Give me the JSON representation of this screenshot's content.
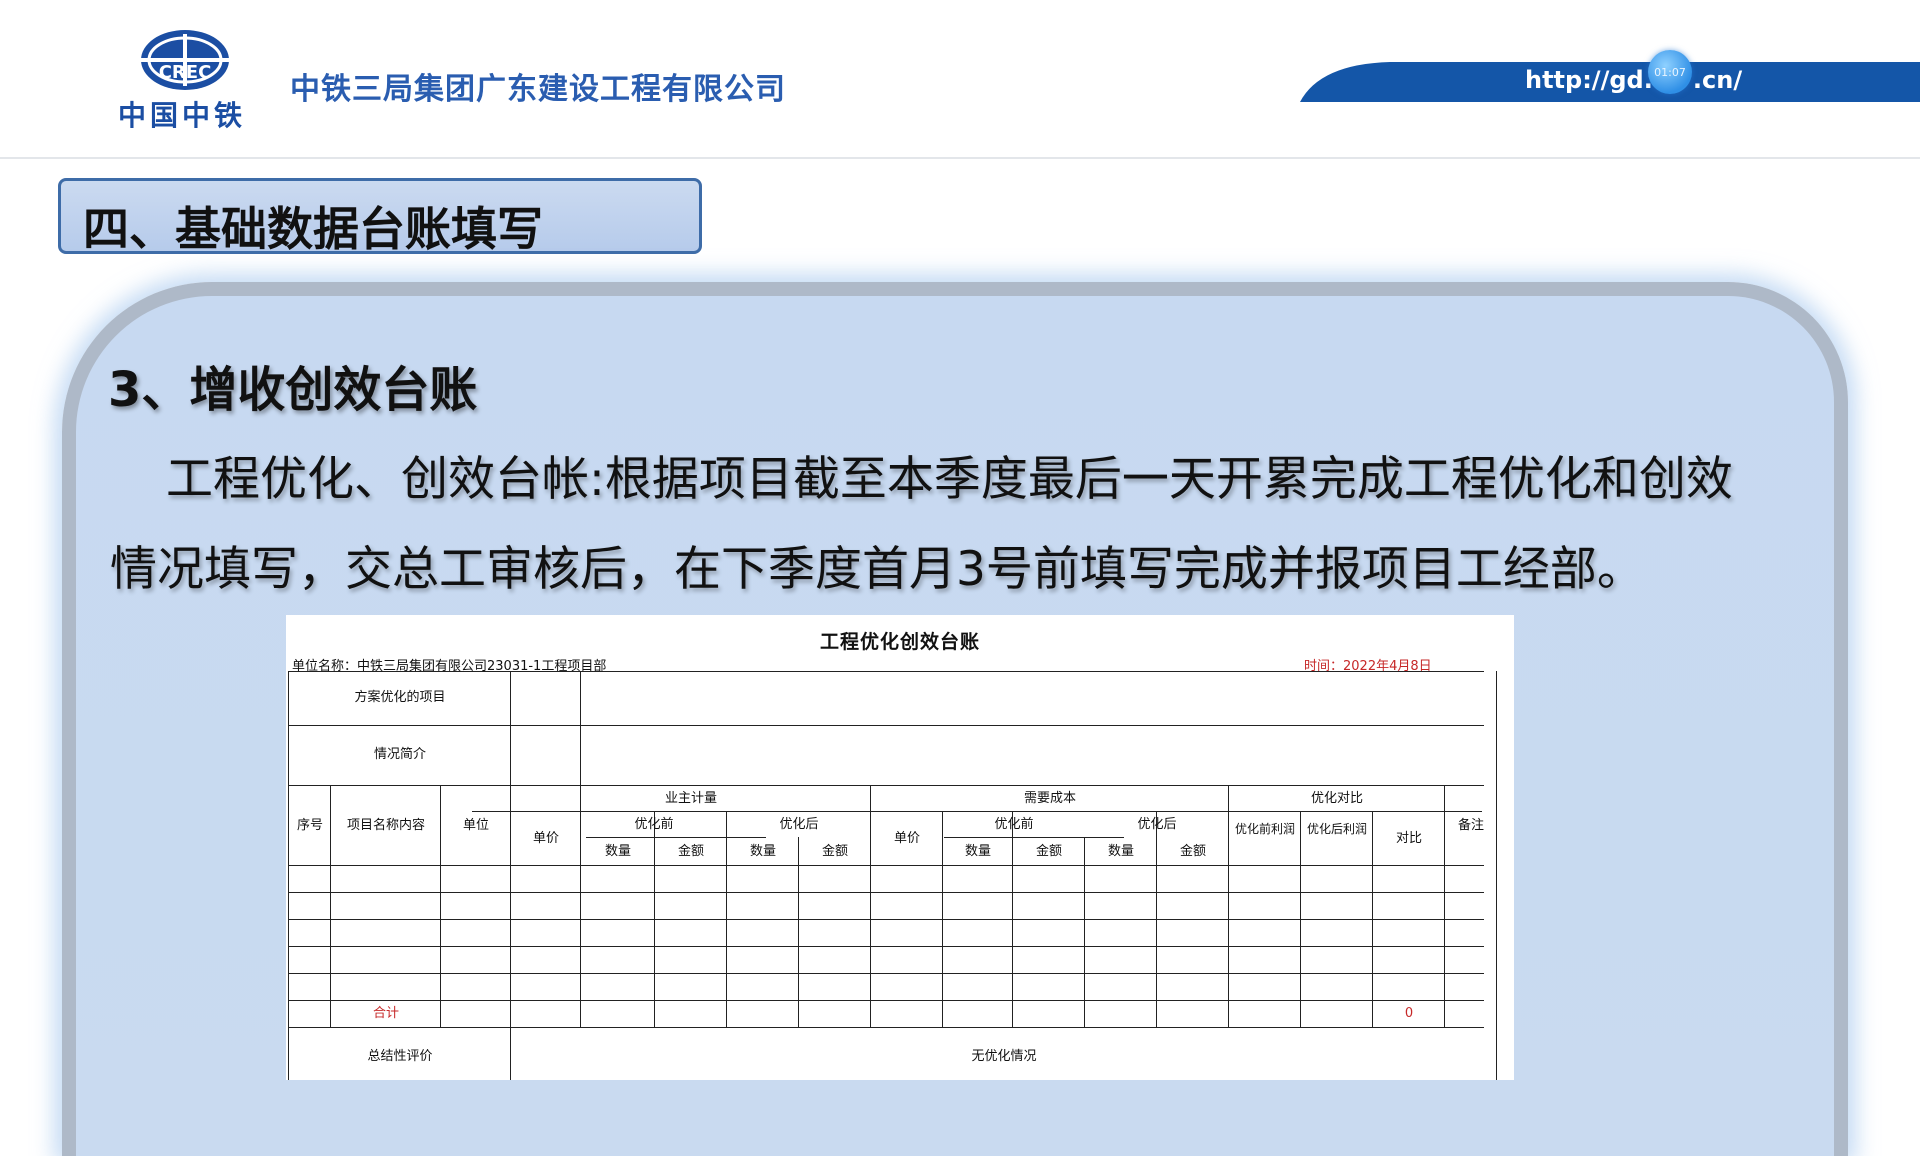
{
  "header": {
    "logo_text": "中国中铁",
    "logo_mark": "CREC",
    "company_name": "中铁三局集团广东建设工程有限公司",
    "url": "http://gd.",
    "url_suffix": ".cn/",
    "timer": "01:07"
  },
  "section": {
    "title": "四、基础数据台账填写"
  },
  "content": {
    "subtitle": "3、增收创效台账",
    "line1": "工程优化、创效台帐:根据项目截至本季度最后一天开累完成工程优化和创效",
    "line2": "情况填写，交总工审核后，在下季度首月3号前填写完成并报项目工经部。"
  },
  "sheet": {
    "title": "工程优化创效台账",
    "unit": "单位名称：中铁三局集团有限公司23031-1工程项目部",
    "time": "时间：2022年4月8日",
    "row_scheme": "方案优化的项目",
    "row_brief": "情况简介",
    "col_seq": "序号",
    "col_item": "项目名称内容",
    "col_unit": "单位",
    "grp_owner": "业主计量",
    "grp_cost": "需要成本",
    "grp_compare": "优化对比",
    "col_price": "单价",
    "col_price2": "单价",
    "sub_before": "优化前",
    "sub_after": "优化后",
    "sub_before2": "优化前",
    "sub_after2": "优化后",
    "qty": "数量",
    "amt": "金额",
    "profit_before": "优化前利润",
    "profit_after": "优化后利润",
    "ratio": "对比",
    "remark": "备注",
    "total": "合计",
    "total_value": "0",
    "summary_label": "总结性评价",
    "summary_value": "无优化情况"
  }
}
